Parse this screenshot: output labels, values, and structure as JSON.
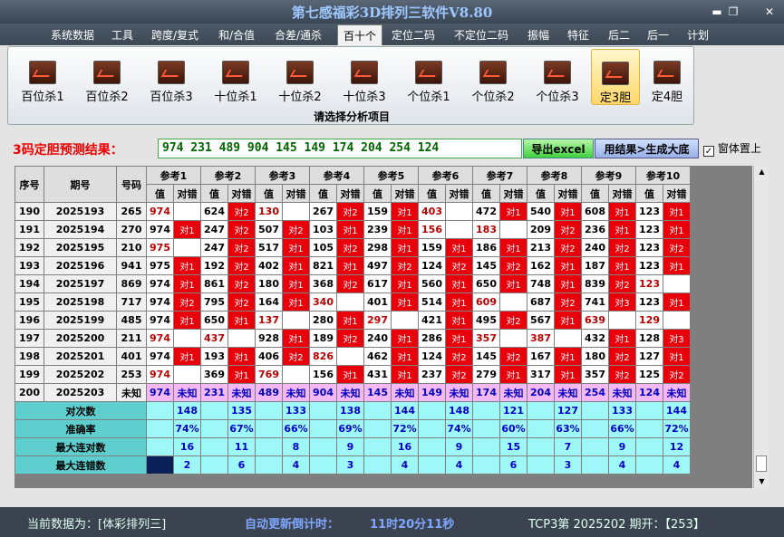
{
  "window": {
    "title": "第七感福彩3D排列三软件V8.80"
  },
  "menu": [
    "系统数据",
    "工具",
    "跨度/复式",
    "和/合值",
    "合差/通杀",
    "百十个",
    "定位二码",
    "不定位二码",
    "振幅",
    "特征",
    "后二",
    "后一",
    "计划"
  ],
  "menu_active": "百十个",
  "ribbon": {
    "buttons": [
      "百位杀1",
      "百位杀2",
      "百位杀3",
      "十位杀1",
      "十位杀2",
      "十位杀3",
      "个位杀1",
      "个位杀2",
      "个位杀3",
      "定3胆",
      "定4胆"
    ],
    "selected": "定3胆",
    "group_label": "请选择分析项目"
  },
  "result": {
    "label": "3码定胆预测结果：",
    "value": "974 231 489 904 145 149 174 204 254 124",
    "export_label": "导出excel",
    "generate_label": "用结果>生成大底",
    "ontop_label": "窗体置上",
    "ontop_checked": "✓"
  },
  "table": {
    "head_seq": "序号",
    "head_period": "期号",
    "head_code": "号码",
    "groups": [
      "参考1",
      "参考2",
      "参考3",
      "参考4",
      "参考5",
      "参考6",
      "参考7",
      "参考8",
      "参考9",
      "参考10"
    ],
    "sub_val": "值",
    "sub_ok": "对错",
    "rows": [
      {
        "seq": "190",
        "period": "2025193",
        "code": "265",
        "cells": [
          [
            "974",
            1,
            ""
          ],
          [
            "624",
            0,
            "对2"
          ],
          [
            "130",
            1,
            ""
          ],
          [
            "267",
            0,
            "对2"
          ],
          [
            "159",
            0,
            "对1"
          ],
          [
            "403",
            1,
            ""
          ],
          [
            "472",
            0,
            "对1"
          ],
          [
            "540",
            0,
            "对1"
          ],
          [
            "608",
            0,
            "对1"
          ],
          [
            "123",
            0,
            "对1"
          ]
        ]
      },
      {
        "seq": "191",
        "period": "2025194",
        "code": "270",
        "cells": [
          [
            "974",
            0,
            "对1"
          ],
          [
            "247",
            0,
            "对2"
          ],
          [
            "507",
            0,
            "对2"
          ],
          [
            "103",
            0,
            "对1"
          ],
          [
            "239",
            0,
            "对1"
          ],
          [
            "156",
            1,
            ""
          ],
          [
            "183",
            1,
            ""
          ],
          [
            "209",
            0,
            "对2"
          ],
          [
            "236",
            0,
            "对1"
          ],
          [
            "123",
            0,
            "对1"
          ]
        ]
      },
      {
        "seq": "192",
        "period": "2025195",
        "code": "210",
        "cells": [
          [
            "975",
            1,
            ""
          ],
          [
            "247",
            0,
            "对2"
          ],
          [
            "517",
            0,
            "对1"
          ],
          [
            "105",
            0,
            "对2"
          ],
          [
            "298",
            0,
            "对1"
          ],
          [
            "159",
            0,
            "对1"
          ],
          [
            "186",
            0,
            "对1"
          ],
          [
            "213",
            0,
            "对2"
          ],
          [
            "240",
            0,
            "对2"
          ],
          [
            "123",
            0,
            "对2"
          ]
        ]
      },
      {
        "seq": "193",
        "period": "2025196",
        "code": "941",
        "cells": [
          [
            "975",
            0,
            "对1"
          ],
          [
            "192",
            0,
            "对2"
          ],
          [
            "402",
            0,
            "对1"
          ],
          [
            "821",
            0,
            "对1"
          ],
          [
            "497",
            0,
            "对2"
          ],
          [
            "124",
            0,
            "对2"
          ],
          [
            "145",
            0,
            "对2"
          ],
          [
            "162",
            0,
            "对1"
          ],
          [
            "187",
            0,
            "对1"
          ],
          [
            "123",
            0,
            "对1"
          ]
        ]
      },
      {
        "seq": "194",
        "period": "2025197",
        "code": "869",
        "cells": [
          [
            "974",
            0,
            "对1"
          ],
          [
            "861",
            0,
            "对2"
          ],
          [
            "180",
            0,
            "对1"
          ],
          [
            "368",
            0,
            "对2"
          ],
          [
            "617",
            0,
            "对1"
          ],
          [
            "560",
            0,
            "对1"
          ],
          [
            "650",
            0,
            "对1"
          ],
          [
            "748",
            0,
            "对1"
          ],
          [
            "839",
            0,
            "对2"
          ],
          [
            "123",
            1,
            ""
          ]
        ]
      },
      {
        "seq": "195",
        "period": "2025198",
        "code": "717",
        "cells": [
          [
            "974",
            0,
            "对2"
          ],
          [
            "795",
            0,
            "对2"
          ],
          [
            "164",
            0,
            "对1"
          ],
          [
            "340",
            1,
            ""
          ],
          [
            "401",
            0,
            "对1"
          ],
          [
            "514",
            0,
            "对1"
          ],
          [
            "609",
            1,
            ""
          ],
          [
            "687",
            0,
            "对2"
          ],
          [
            "741",
            0,
            "对3"
          ],
          [
            "123",
            0,
            "对1"
          ]
        ]
      },
      {
        "seq": "196",
        "period": "2025199",
        "code": "485",
        "cells": [
          [
            "974",
            0,
            "对1"
          ],
          [
            "650",
            0,
            "对1"
          ],
          [
            "137",
            1,
            ""
          ],
          [
            "280",
            0,
            "对1"
          ],
          [
            "297",
            1,
            ""
          ],
          [
            "421",
            0,
            "对1"
          ],
          [
            "495",
            0,
            "对2"
          ],
          [
            "567",
            0,
            "对1"
          ],
          [
            "639",
            1,
            ""
          ],
          [
            "129",
            1,
            ""
          ]
        ]
      },
      {
        "seq": "197",
        "period": "2025200",
        "code": "211",
        "cells": [
          [
            "974",
            1,
            ""
          ],
          [
            "437",
            1,
            ""
          ],
          [
            "928",
            0,
            "对1"
          ],
          [
            "189",
            0,
            "对2"
          ],
          [
            "240",
            0,
            "对1"
          ],
          [
            "286",
            0,
            "对1"
          ],
          [
            "357",
            1,
            ""
          ],
          [
            "387",
            1,
            ""
          ],
          [
            "432",
            0,
            "对1"
          ],
          [
            "128",
            0,
            "对3"
          ]
        ]
      },
      {
        "seq": "198",
        "period": "2025201",
        "code": "401",
        "cells": [
          [
            "974",
            0,
            "对1"
          ],
          [
            "193",
            0,
            "对1"
          ],
          [
            "406",
            0,
            "对2"
          ],
          [
            "826",
            1,
            ""
          ],
          [
            "462",
            0,
            "对1"
          ],
          [
            "124",
            0,
            "对2"
          ],
          [
            "145",
            0,
            "对2"
          ],
          [
            "167",
            0,
            "对1"
          ],
          [
            "180",
            0,
            "对2"
          ],
          [
            "127",
            0,
            "对1"
          ]
        ]
      },
      {
        "seq": "199",
        "period": "2025202",
        "code": "253",
        "cells": [
          [
            "974",
            1,
            ""
          ],
          [
            "369",
            0,
            "对1"
          ],
          [
            "769",
            1,
            ""
          ],
          [
            "156",
            0,
            "对1"
          ],
          [
            "431",
            0,
            "对1"
          ],
          [
            "237",
            0,
            "对2"
          ],
          [
            "279",
            0,
            "对1"
          ],
          [
            "317",
            0,
            "对1"
          ],
          [
            "357",
            0,
            "对2"
          ],
          [
            "125",
            0,
            "对2"
          ]
        ]
      }
    ],
    "last": {
      "seq": "200",
      "period": "2025203",
      "code": "未知",
      "values": [
        "974",
        "231",
        "489",
        "904",
        "145",
        "149",
        "174",
        "204",
        "254",
        "124"
      ],
      "unknown": "未知"
    },
    "stats": [
      {
        "label": "对次数",
        "values": [
          "148",
          "135",
          "133",
          "138",
          "144",
          "148",
          "121",
          "127",
          "133",
          "144"
        ]
      },
      {
        "label": "准确率",
        "values": [
          "74%",
          "67%",
          "66%",
          "69%",
          "72%",
          "74%",
          "60%",
          "63%",
          "66%",
          "72%"
        ]
      },
      {
        "label": "最大连对数",
        "values": [
          "16",
          "11",
          "8",
          "9",
          "16",
          "9",
          "15",
          "7",
          "9",
          "12"
        ]
      },
      {
        "label": "最大连错数",
        "values": [
          "2",
          "6",
          "4",
          "3",
          "4",
          "4",
          "6",
          "3",
          "4",
          "4"
        ]
      }
    ]
  },
  "status": {
    "source": "当前数据为：[体彩排列三]",
    "countdown_label": "自动更新倒计时：",
    "countdown": "11时20分11秒",
    "draw": "TCP3第 2025202 期开：【253】"
  }
}
